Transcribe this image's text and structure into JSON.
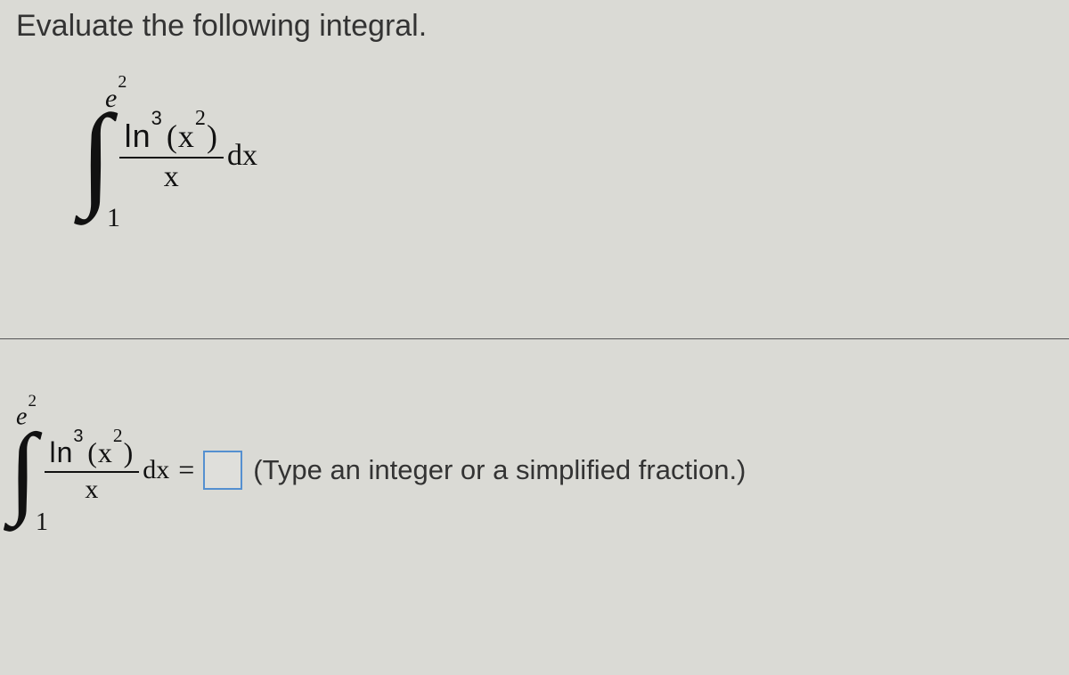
{
  "prompt": "Evaluate the following integral.",
  "integral": {
    "upper_e": "e",
    "upper_exp": "2",
    "lower": "1",
    "ln_label": "ln",
    "ln_exp": "3",
    "arg": "x",
    "arg_exp": "2",
    "denom": "x",
    "dx": "dx"
  },
  "equals": "=",
  "hint": "(Type an integer or a simplified fraction.)",
  "chart_data": {
    "type": "table",
    "expression_latex": "\\int_{1}^{e^{2}} \\frac{\\ln^{3}(x^{2})}{x}\\,dx",
    "answer_field": "empty"
  }
}
